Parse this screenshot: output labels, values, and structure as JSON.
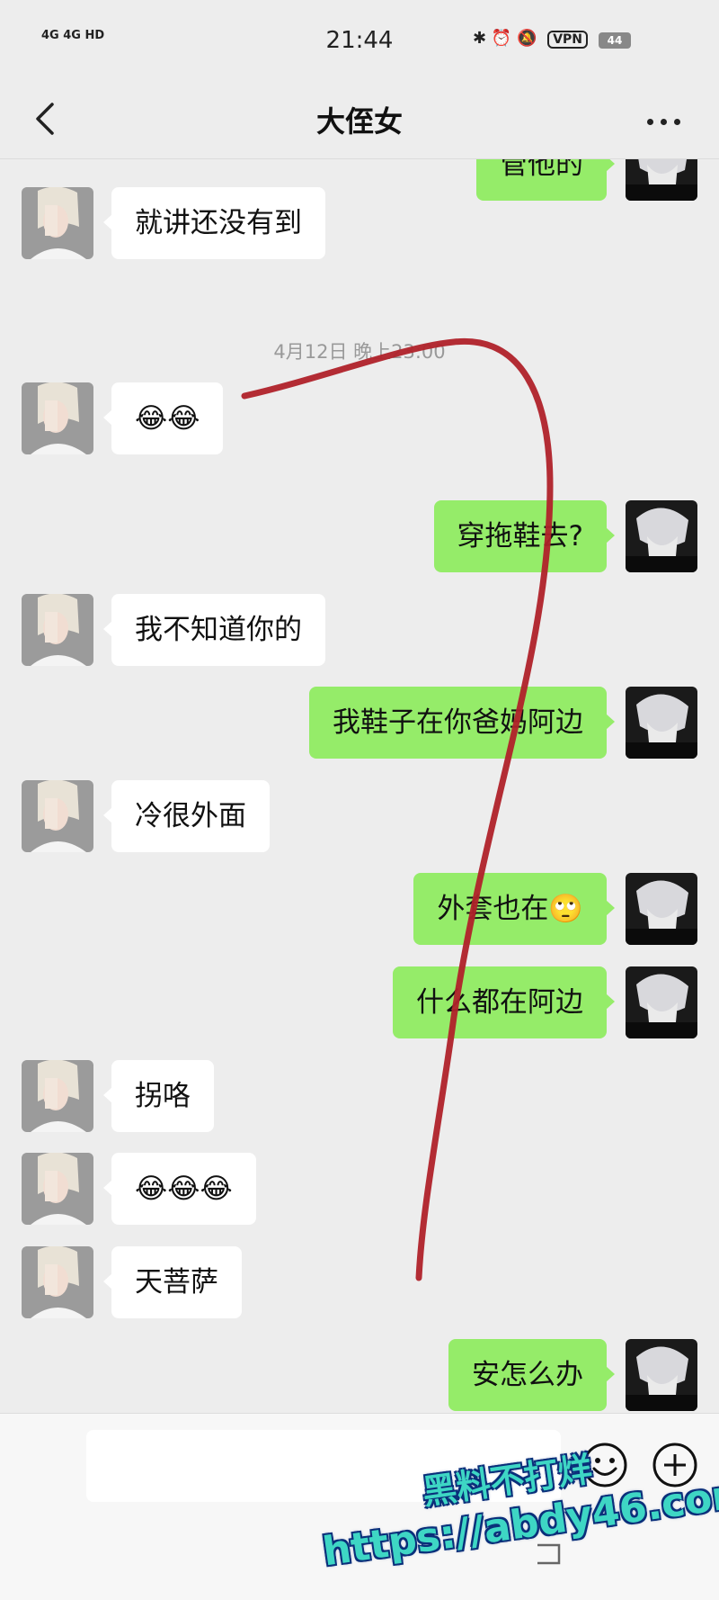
{
  "status_bar": {
    "signal": "4G 4G HD",
    "time": "21:44",
    "vpn": "VPN",
    "battery": "44"
  },
  "header": {
    "title": "大侄女"
  },
  "messages": [
    {
      "side": "out",
      "text": "管他的"
    },
    {
      "side": "in",
      "text": "就讲还没有到"
    },
    {
      "timestamp": "4月12日 晚上23:00"
    },
    {
      "side": "in",
      "text": "😂😂"
    },
    {
      "side": "out",
      "text": "穿拖鞋去?"
    },
    {
      "side": "in",
      "text": "我不知道你的"
    },
    {
      "side": "out",
      "text": "我鞋子在你爸妈阿边"
    },
    {
      "side": "in",
      "text": "冷很外面"
    },
    {
      "side": "out",
      "text": "外套也在🙄"
    },
    {
      "side": "out",
      "text": "什么都在阿边"
    },
    {
      "side": "in",
      "text": "拐咯"
    },
    {
      "side": "in",
      "text": "😂😂😂"
    },
    {
      "side": "in",
      "text": "天菩萨"
    },
    {
      "side": "out",
      "text": "安怎么办"
    }
  ],
  "watermark": {
    "line1": "黑料不打烊",
    "line2": "https://abdy46.com"
  },
  "colors": {
    "background": "#ededed",
    "bubble_out": "#95ec69",
    "bubble_in": "#ffffff",
    "annotation_stroke": "#b0222a"
  },
  "icons": [
    "back-icon",
    "more-icon",
    "emoji-icon",
    "plus-icon"
  ]
}
